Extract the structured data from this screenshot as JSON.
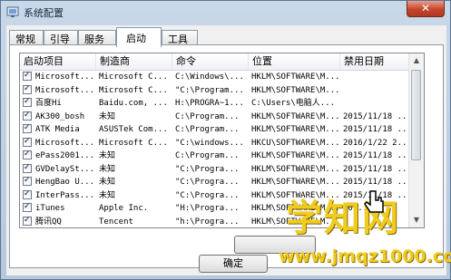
{
  "window": {
    "title": "系统配置",
    "close_glyph": "✕"
  },
  "tabs": [
    {
      "label": "常规"
    },
    {
      "label": "引导"
    },
    {
      "label": "服务"
    },
    {
      "label": "启动",
      "active": true
    },
    {
      "label": "工具"
    }
  ],
  "table": {
    "columns": [
      "启动项目",
      "制造商",
      "命令",
      "位置",
      "禁用日期"
    ],
    "rows": [
      {
        "checked": true,
        "item": "Microsoft...",
        "maker": "Microsoft C...",
        "command": "C:\\Windows\\...",
        "location": "HKLM\\SOFTWARE\\M...",
        "date": ""
      },
      {
        "checked": true,
        "item": "Microsoft...",
        "maker": "Microsoft C...",
        "command": "\"C:\\Program...",
        "location": "HKLM\\SOFTWARE\\M...",
        "date": ""
      },
      {
        "checked": true,
        "item": "百度Hi",
        "maker": "Baidu.com, ...",
        "command": "H:\\PROGRA~1...",
        "location": "C:\\Users\\电脑人...",
        "date": ""
      },
      {
        "checked": true,
        "item": "AK300_bosh",
        "maker": "未知",
        "command": "C:\\Program...",
        "location": "HKLM\\SOFTWARE\\M...",
        "date": "2015/11/18 ..."
      },
      {
        "checked": true,
        "item": "ATK Media",
        "maker": "ASUSTek Com...",
        "command": "C:\\Program...",
        "location": "HKLM\\SOFTWARE\\M...",
        "date": "2015/11/18 ..."
      },
      {
        "checked": true,
        "item": "Microsoft...",
        "maker": "Microsoft C...",
        "command": "\"C:\\windows...",
        "location": "HKCU\\SOFTWARE\\M...",
        "date": "2016/1/22 2..."
      },
      {
        "checked": true,
        "item": "ePass2001...",
        "maker": "未知",
        "command": "C:\\Program...",
        "location": "HKLM\\SOFTWARE\\M...",
        "date": "2015/11/18 ..."
      },
      {
        "checked": true,
        "item": "GVDelaySt...",
        "maker": "未知",
        "command": "\"C:\\Progra...",
        "location": "HKLM\\SOFTWARE\\M...",
        "date": "2015/11/18 ..."
      },
      {
        "checked": true,
        "item": "HengBao U...",
        "maker": "未知",
        "command": "\"C:\\Progra...",
        "location": "HKLM\\SOFTWARE\\M...",
        "date": "2015/11/18 ..."
      },
      {
        "checked": true,
        "item": "InterPass...",
        "maker": "未知",
        "command": "\"C:\\Progra...",
        "location": "HKLM\\SOFTWARE\\M...",
        "date": "2015/11/18 ..."
      },
      {
        "checked": true,
        "item": "iTunes",
        "maker": "Apple Inc.",
        "command": "\"H:\\Progra...",
        "location": "HKLM\\SOFTWARE\\M...",
        "date": "201..."
      },
      {
        "checked": true,
        "item": "腾讯QQ",
        "maker": "Tencent",
        "command": "\"h:\\Progra...",
        "location": "HKLM\\SOFTWARE\\M...",
        "date": ""
      }
    ]
  },
  "buttons": {
    "ok": "确定"
  },
  "watermark": {
    "brand": "学知网",
    "url": "www.jmqz1000.com"
  },
  "colors": {
    "accent_close": "#c5442a",
    "watermark": "#f0cc20"
  }
}
